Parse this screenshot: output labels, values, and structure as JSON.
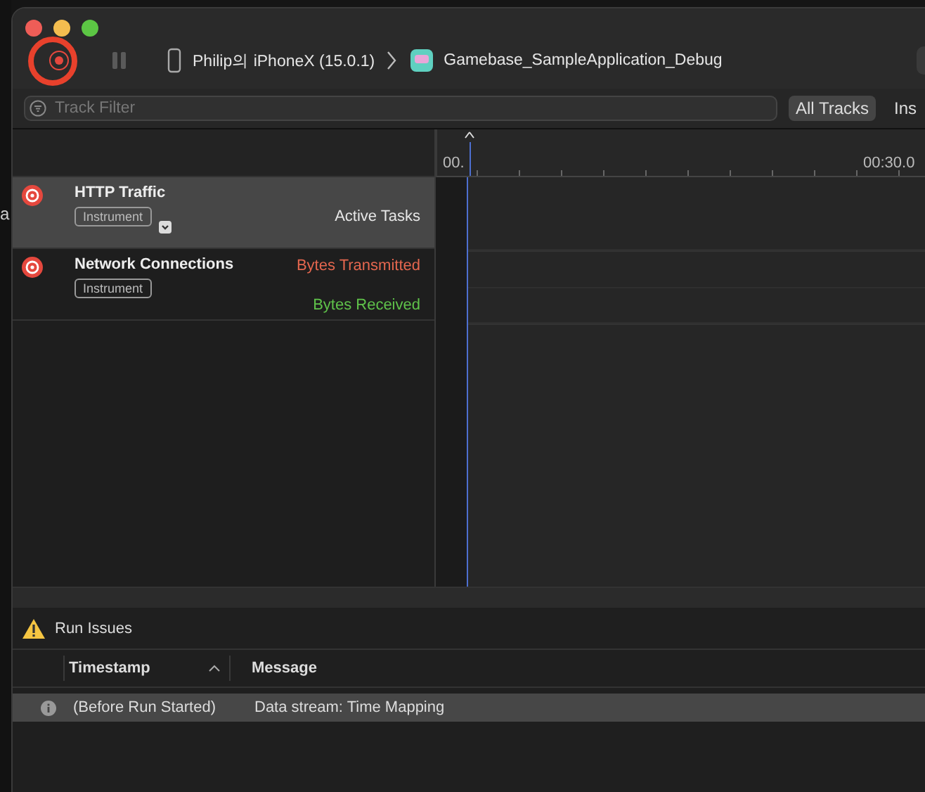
{
  "backdrop_text": "a",
  "toolbar": {
    "recording": false,
    "device": "Philip의 iPhoneX (15.0.1)",
    "target": "Gamebase_SampleApplication_Debug"
  },
  "filter": {
    "placeholder": "Track Filter",
    "scopes": [
      {
        "label": "All Tracks",
        "selected": true
      },
      {
        "label": "Ins",
        "selected": false
      }
    ]
  },
  "ruler": {
    "labels": [
      "00.",
      "00:30.0"
    ]
  },
  "tracks": [
    {
      "name": "HTTP Traffic",
      "tag": "Instrument",
      "selected": true,
      "has_menu": true,
      "series": [
        {
          "label": "Active Tasks",
          "color": "#e6e6e6"
        }
      ]
    },
    {
      "name": "Network Connections",
      "tag": "Instrument",
      "selected": false,
      "has_menu": false,
      "series": [
        {
          "label": "Bytes Transmitted",
          "color": "#e5674f"
        },
        {
          "label": "Bytes Received",
          "color": "#5fc24a"
        }
      ]
    }
  ],
  "issues": {
    "title": "Run Issues",
    "columns": [
      {
        "label": "Timestamp",
        "sorted": true
      },
      {
        "label": "Message",
        "sorted": false
      }
    ],
    "rows": [
      {
        "timestamp": "(Before Run Started)",
        "message": "Data stream: Time Mapping",
        "selected": true
      }
    ]
  }
}
